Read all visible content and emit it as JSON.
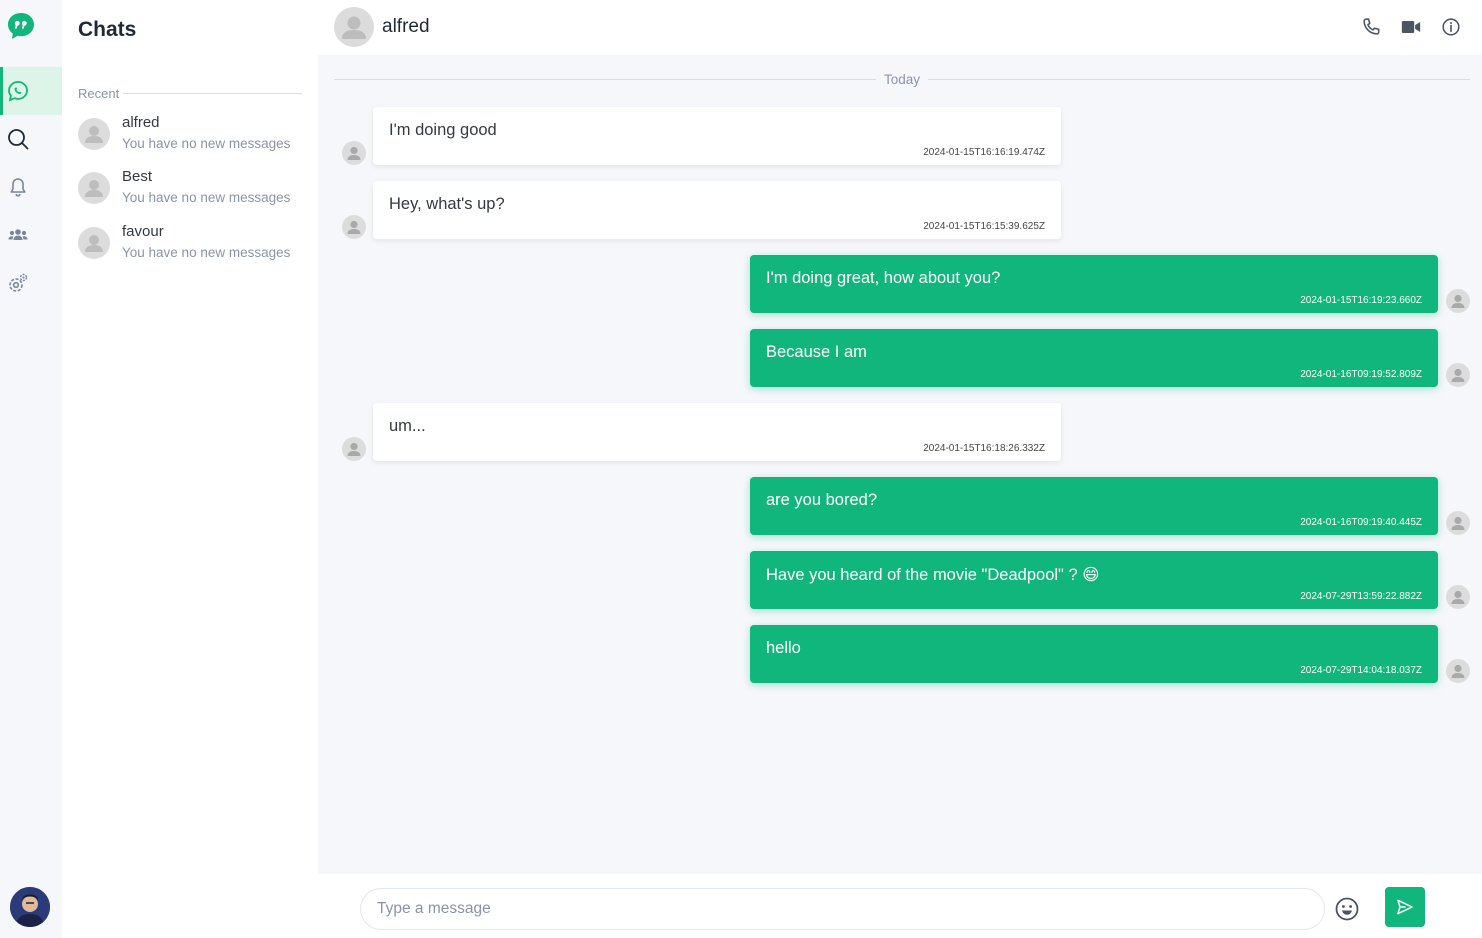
{
  "colors": {
    "accent": "#11b67c",
    "rail_bg": "#f5f7fb",
    "muted": "#8a94a6",
    "active_bg": "#dcf5e8"
  },
  "rail": {
    "items": [
      {
        "icon": "chat-icon",
        "active": true
      },
      {
        "icon": "search-icon",
        "active": false
      },
      {
        "icon": "bell-icon",
        "active": false
      },
      {
        "icon": "group-icon",
        "active": false
      },
      {
        "icon": "settings-icon",
        "active": false
      }
    ]
  },
  "sidebar": {
    "title": "Chats",
    "recent_label": "Recent",
    "contacts": [
      {
        "name": "alfred",
        "preview": "You have no new messages"
      },
      {
        "name": "Best",
        "preview": "You have no new messages"
      },
      {
        "name": "favour",
        "preview": "You have no new messages"
      }
    ]
  },
  "chat": {
    "contact_name": "alfred",
    "date_divider": "Today",
    "header_icons": [
      "phone-icon",
      "video-icon",
      "info-icon"
    ],
    "messages": [
      {
        "direction": "in",
        "text": "I'm doing good",
        "timestamp": "2024-01-15T16:16:19.474Z"
      },
      {
        "direction": "in",
        "text": "Hey, what's up?",
        "timestamp": "2024-01-15T16:15:39.625Z"
      },
      {
        "direction": "out",
        "text": "I'm doing great, how about you?",
        "timestamp": "2024-01-15T16:19:23.660Z"
      },
      {
        "direction": "out",
        "text": "Because I am",
        "timestamp": "2024-01-16T09:19:52.809Z"
      },
      {
        "direction": "in",
        "text": "um...",
        "timestamp": "2024-01-15T16:18:26.332Z"
      },
      {
        "direction": "out",
        "text": "are you bored?",
        "timestamp": "2024-01-16T09:19:40.445Z"
      },
      {
        "direction": "out",
        "text": "Have you heard of the movie \"Deadpool\" ? 😄",
        "timestamp": "2024-07-29T13:59:22.882Z"
      },
      {
        "direction": "out",
        "text": "hello",
        "timestamp": "2024-07-29T14:04:18.037Z"
      }
    ]
  },
  "composer": {
    "placeholder": "Type a message",
    "value": ""
  }
}
